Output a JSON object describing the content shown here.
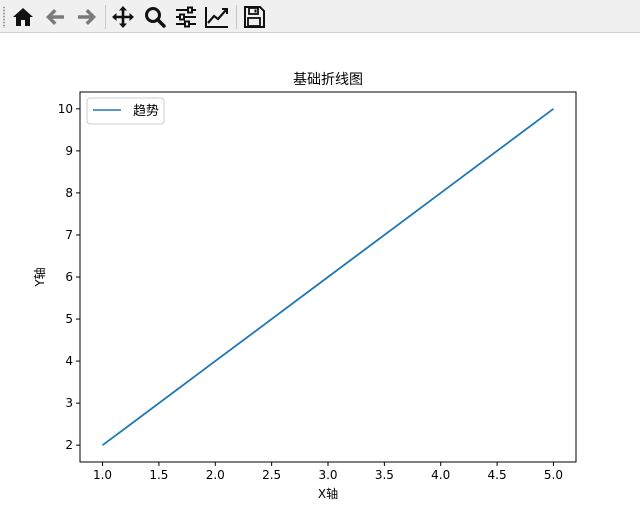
{
  "toolbar": {
    "buttons": [
      {
        "name": "home-icon",
        "label": "Home"
      },
      {
        "name": "back-icon",
        "label": "Back"
      },
      {
        "name": "forward-icon",
        "label": "Forward"
      },
      {
        "name": "pan-icon",
        "label": "Pan"
      },
      {
        "name": "zoom-icon",
        "label": "Zoom"
      },
      {
        "name": "configure-subplots-icon",
        "label": "Subplots"
      },
      {
        "name": "edit-axis-icon",
        "label": "Customize"
      },
      {
        "name": "save-icon",
        "label": "Save"
      }
    ]
  },
  "colors": {
    "line": "#1f77b4",
    "toolbar_bg": "#f0f0f0",
    "icon": "#111111",
    "icon_disabled": "#7a7a7a"
  },
  "chart_data": {
    "type": "line",
    "title": "基础折线图",
    "xlabel": "X轴",
    "ylabel": "Y轴",
    "xlim": [
      0.8,
      5.2
    ],
    "ylim": [
      1.6,
      10.4
    ],
    "xticks": [
      1.0,
      1.5,
      2.0,
      2.5,
      3.0,
      3.5,
      4.0,
      4.5,
      5.0
    ],
    "xtick_labels": [
      "1.0",
      "1.5",
      "2.0",
      "2.5",
      "3.0",
      "3.5",
      "4.0",
      "4.5",
      "5.0"
    ],
    "yticks": [
      2,
      3,
      4,
      5,
      6,
      7,
      8,
      9,
      10
    ],
    "ytick_labels": [
      "2",
      "3",
      "4",
      "5",
      "6",
      "7",
      "8",
      "9",
      "10"
    ],
    "grid": false,
    "legend_position": "upper-left",
    "series": [
      {
        "name": "趋势",
        "x": [
          1,
          2,
          3,
          4,
          5
        ],
        "y": [
          2,
          4,
          6,
          8,
          10
        ],
        "color": "#1f77b4"
      }
    ]
  }
}
